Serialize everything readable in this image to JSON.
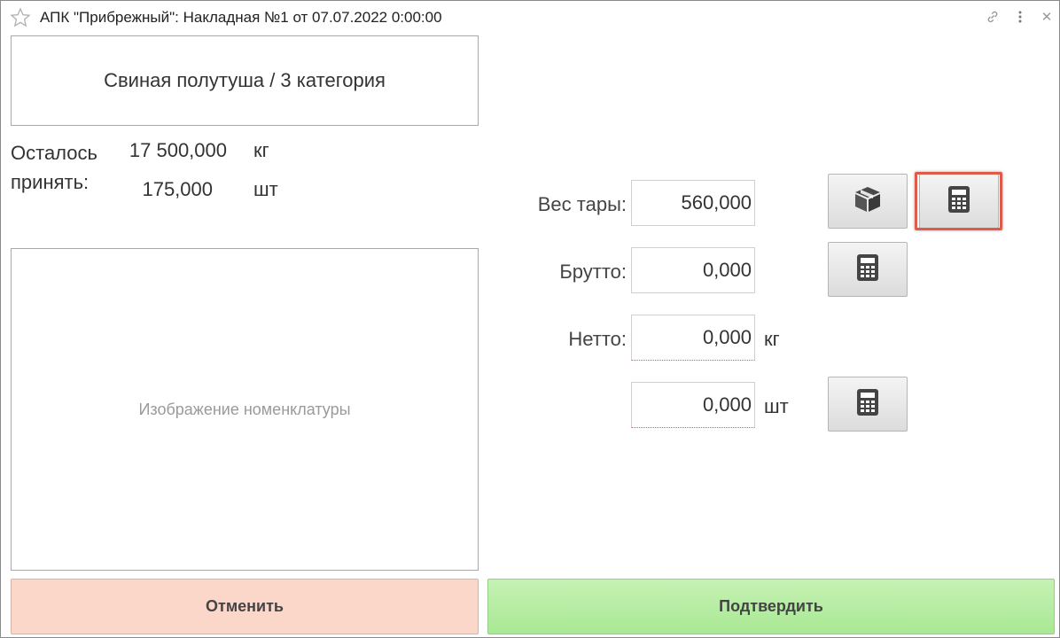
{
  "window": {
    "title": "АПК \"Прибрежный\": Накладная №1 от 07.07.2022 0:00:00"
  },
  "product": {
    "name": "Свиная полутуша / 3 категория"
  },
  "remaining": {
    "label": "Осталось принять:",
    "weight_value": "17 500,000",
    "weight_unit": "кг",
    "count_value": "175,000",
    "count_unit": "шт"
  },
  "image_placeholder": "Изображение номенклатуры",
  "form": {
    "tara_label": "Вес тары:",
    "tara_value": "560,000",
    "brutto_label": "Брутто:",
    "brutto_value": "0,000",
    "netto_label": "Нетто:",
    "netto_value": "0,000",
    "netto_unit": "кг",
    "pieces_value": "0,000",
    "pieces_unit": "шт"
  },
  "buttons": {
    "cancel": "Отменить",
    "confirm": "Подтвердить"
  },
  "icons": {
    "favorite": "star-icon",
    "link": "link-icon",
    "more": "more-vertical-icon",
    "close": "close-icon",
    "package": "package-icon",
    "calculator": "calculator-icon"
  },
  "colors": {
    "cancel_bg": "#fbd7c9",
    "confirm_bg": "#b6ed a2",
    "highlight": "#e05a4a"
  }
}
